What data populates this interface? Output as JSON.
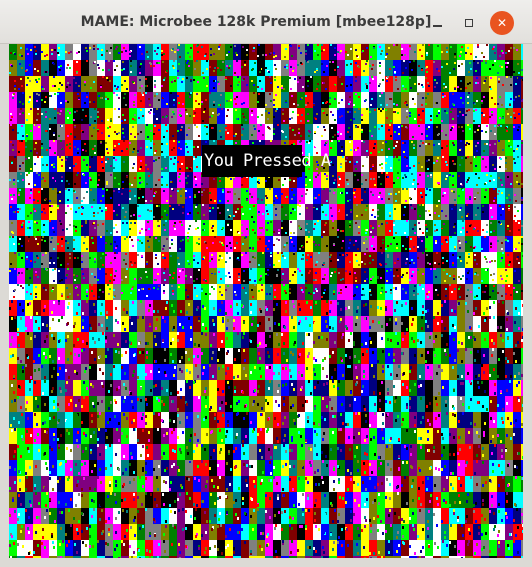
{
  "window": {
    "title": "MAME: Microbee 128k Premium [mbee128p]",
    "controls": {
      "minimize_icon": "minimize-icon",
      "maximize_icon": "maximize-icon",
      "close_icon": "close-icon",
      "close_glyph": "✕"
    },
    "close_color": "#e95420"
  },
  "screen": {
    "message": "You Pressed A",
    "palette": [
      "#000000",
      "#0000ff",
      "#00ff00",
      "#00ffff",
      "#ff0000",
      "#ff00ff",
      "#ffff00",
      "#ffffff",
      "#808080",
      "#008000",
      "#800080",
      "#808000",
      "#000080",
      "#008080",
      "#800000"
    ]
  }
}
